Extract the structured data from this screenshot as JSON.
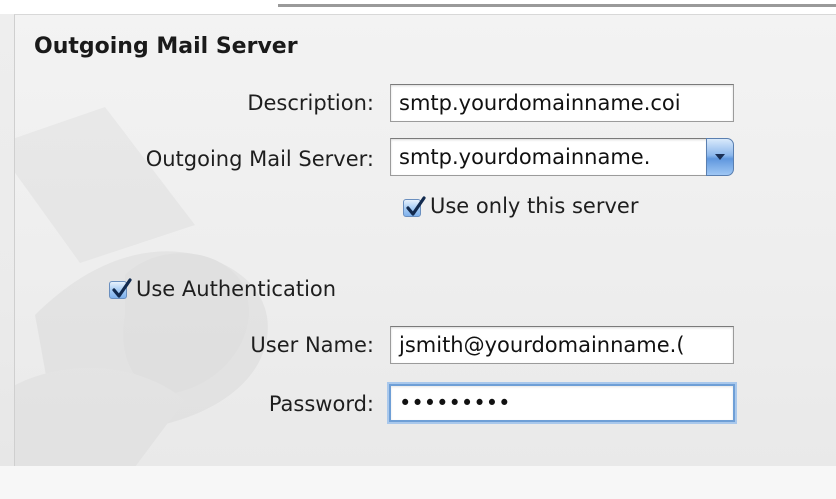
{
  "section": {
    "title": "Outgoing Mail Server"
  },
  "fields": {
    "description": {
      "label": "Description:",
      "value": "smtp.yourdomainname.coi"
    },
    "outgoing_server": {
      "label": "Outgoing Mail Server:",
      "value": "smtp.yourdomainname."
    },
    "use_only_this_server": {
      "label": "Use only this server",
      "checked": true
    },
    "use_authentication": {
      "label": "Use Authentication",
      "checked": true
    },
    "user_name": {
      "label": "User Name:",
      "value": "jsmith@yourdomainname.("
    },
    "password": {
      "label": "Password:",
      "value": "•••••••••"
    }
  },
  "icons": {
    "checkbox": "checkmark-icon",
    "dropdown": "chevron-down-icon"
  },
  "colors": {
    "focus_ring": "#6f9fd6",
    "checkbox_fill": "#a8cdf5",
    "dropdown_button": "#5f97de"
  }
}
